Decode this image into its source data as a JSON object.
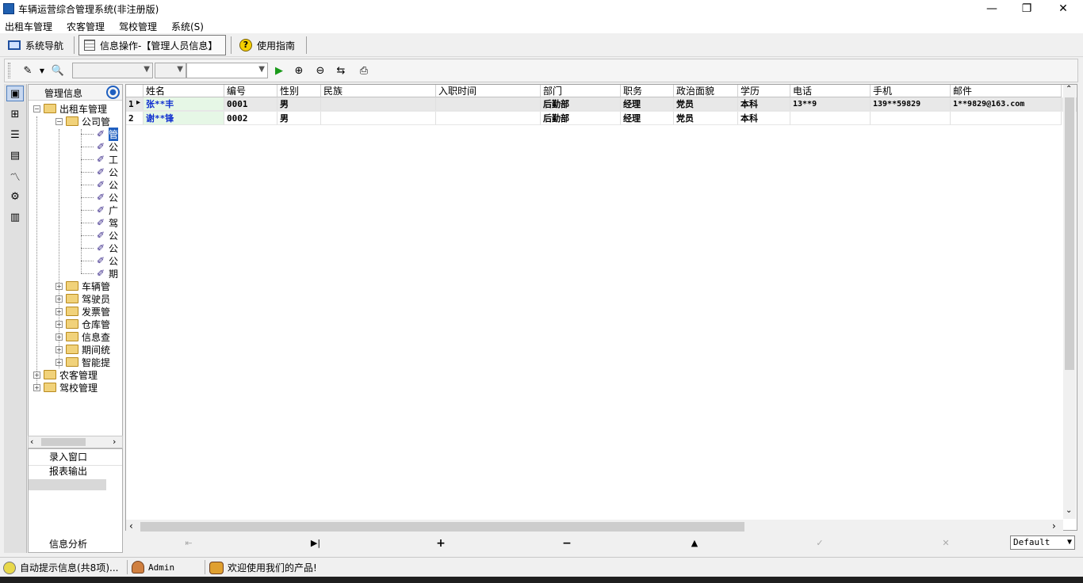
{
  "window": {
    "title": "车辆运营综合管理系统(非注册版)",
    "controls": [
      "—",
      "❐",
      "✕"
    ]
  },
  "menu": [
    "出租车管理",
    "农客管理",
    "驾校管理",
    "系统(S)"
  ],
  "navbar": {
    "system_nav": "系统导航",
    "info_tab": "信息操作-【管理人员信息】",
    "guide": "使用指南"
  },
  "tree": {
    "header": "管理信息",
    "root": "出租车管理",
    "company": "公司管",
    "leaves": [
      "管",
      "公",
      "工",
      "公",
      "公",
      "公",
      "广",
      "驾",
      "公",
      "公",
      "公",
      "期"
    ],
    "folders": [
      "车辆管",
      "驾驶员",
      "发票管",
      "仓库管",
      "信息查",
      "期间统",
      "智能提"
    ],
    "top_folders": [
      "农客管理",
      "驾校管理"
    ]
  },
  "left_bottom": {
    "entry": "录入窗口",
    "report": "报表输出",
    "analysis": "信息分析"
  },
  "grid": {
    "columns": [
      "姓名",
      "编号",
      "性别",
      "民族",
      "入职时间",
      "部门",
      "职务",
      "政治面貌",
      "学历",
      "电话",
      "手机",
      "邮件"
    ],
    "rows": [
      {
        "num": "1",
        "name": "张**丰",
        "id": "0001",
        "gender": "男",
        "nation": "",
        "date": "",
        "dept": "后勤部",
        "title": "经理",
        "party": "党员",
        "edu": "本科",
        "phone": "13**9",
        "mobile": "139**59829",
        "email": "1**9829@163.com"
      },
      {
        "num": "2",
        "name": "谢**锋",
        "id": "0002",
        "gender": "男",
        "nation": "",
        "date": "",
        "dept": "后勤部",
        "title": "经理",
        "party": "党员",
        "edu": "本科",
        "phone": "",
        "mobile": "",
        "email": ""
      }
    ]
  },
  "nav": {
    "default_select": "Default"
  },
  "status": {
    "tips": "自动提示信息(共8项)...",
    "user": "Admin",
    "welcome": "欢迎使用我们的产品!"
  }
}
